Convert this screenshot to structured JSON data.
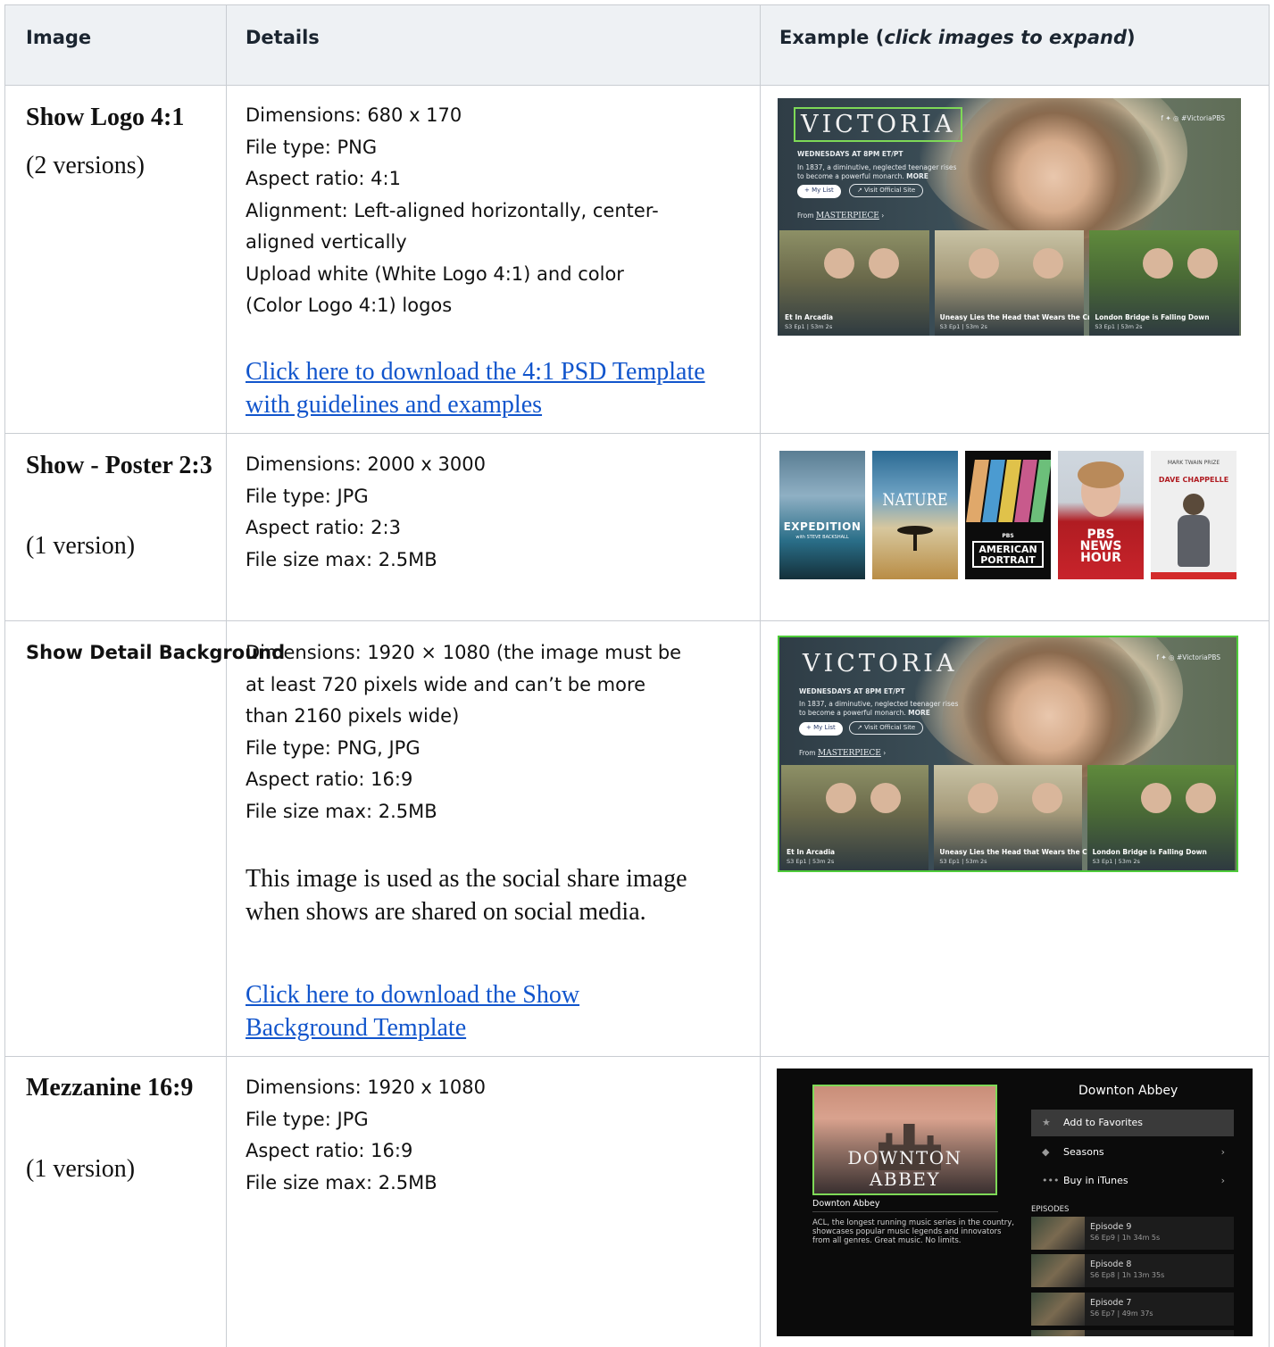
{
  "header": {
    "col_image": "Image",
    "col_details": "Details",
    "col_example_prefix": "Example (",
    "col_example_em": "click images to expand",
    "col_example_suffix": ")"
  },
  "rows": [
    {
      "name": "Show Logo 4:1",
      "sub": "(2 versions)",
      "details": [
        "Dimensions: 680 x 170",
        "File type: PNG",
        "Aspect ratio: 4:1",
        "Alignment: Left-aligned horizontally, center-",
        "aligned vertically",
        "Upload white (White Logo 4:1) and color",
        "(Color Logo 4:1) logos"
      ],
      "link": "Click here to download the 4:1 PSD Template with guidelines and examples"
    },
    {
      "name": "Show - Poster 2:3",
      "sub": "(1 version)",
      "details": [
        "Dimensions: 2000 x 3000",
        "File type: JPG",
        "Aspect ratio: 2:3",
        "File size max: 2.5MB"
      ]
    },
    {
      "name": "Show Detail Background",
      "details": [
        "Dimensions: 1920 × 1080 (the image must be",
        "at least 720 pixels wide and can’t be more",
        "than 2160 pixels wide)",
        "File type: PNG, JPG",
        "Aspect ratio: 16:9",
        "File size max: 2.5MB"
      ],
      "note": "This image is used as the social share image when shows are shared on social media.",
      "link": "Click here to download the Show Background Template"
    },
    {
      "name": "Mezzanine 16:9",
      "sub": "(1 version)",
      "details": [
        "Dimensions: 1920 x 1080",
        "File type: JPG",
        "Aspect ratio: 16:9",
        "File size max: 2.5MB"
      ]
    }
  ],
  "victoria": {
    "logo": "VICTORIA",
    "airtime": "WEDNESDAYS AT 8PM ET/PT",
    "blurb_1": "In 1837, a diminutive, neglected teenager rises",
    "blurb_2": "to become a powerful monarch.",
    "more": "MORE",
    "my_list": "+ My List",
    "visit": "Visit Official Site",
    "from": "From",
    "masterpiece": "MASTERPIECE",
    "social": "f  ✦  ◎  #VictoriaPBS",
    "episodes": [
      {
        "title": "Et In Arcadia",
        "meta": "S3 Ep1 | 53m 2s"
      },
      {
        "title": "Uneasy Lies the Head that Wears the Crown",
        "meta": "S3 Ep1 | 53m 2s"
      },
      {
        "title": "London Bridge is Falling Down",
        "meta": "S3 Ep1 | 53m 2s"
      }
    ]
  },
  "posters": [
    {
      "label": "EXPEDITION",
      "sub": "with STEVE BACKSHALL"
    },
    {
      "label": "NATURE"
    },
    {
      "label": "AMERICAN PORTRAIT",
      "top": "PBS"
    },
    {
      "label": "PBS NEWS HOUR"
    },
    {
      "label": "DAVE CHAPPELLE",
      "top": "MARK TWAIN PRIZE"
    }
  ],
  "downton": {
    "poster_title": "DOWNTON ABBEY",
    "heading": "Downton Abbey",
    "subtitle": "Downton Abbey",
    "desc_1": "ACL, the longest running music series in the country,",
    "desc_2": "showcases popular music legends and innovators",
    "desc_3": "from all genres. Great music. No limits.",
    "menu": [
      {
        "label": "Add to Favorites",
        "icon": "★"
      },
      {
        "label": "Seasons",
        "icon": "◆"
      },
      {
        "label": "Buy in iTunes",
        "icon": "•••"
      }
    ],
    "episodes_label": "EPISODES",
    "episodes": [
      {
        "title": "Episode 9",
        "meta": "S6 Ep9 | 1h 34m 5s"
      },
      {
        "title": "Episode 8",
        "meta": "S6 Ep8 | 1h 13m 35s"
      },
      {
        "title": "Episode 7",
        "meta": "S6 Ep7 | 49m 37s"
      }
    ]
  }
}
